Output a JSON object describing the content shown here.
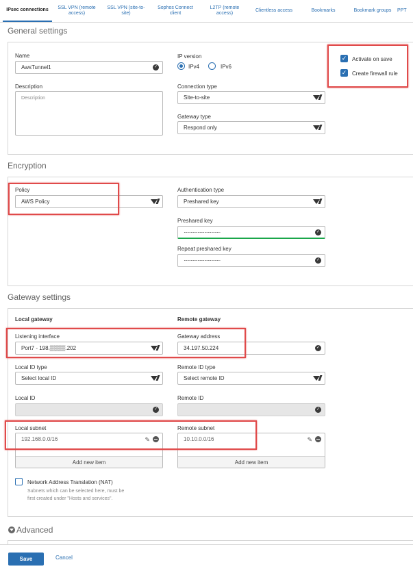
{
  "tabs": [
    {
      "label": "IPsec connections"
    },
    {
      "label": "SSL VPN (remote\naccess)"
    },
    {
      "label": "SSL VPN (site-to-\nsite)"
    },
    {
      "label": "Sophos Connect\nclient"
    },
    {
      "label": "L2TP (remote\naccess)"
    },
    {
      "label": "Clientless access"
    },
    {
      "label": "Bookmarks"
    },
    {
      "label": "Bookmark groups"
    },
    {
      "label": "PPT"
    }
  ],
  "general": {
    "title": "General settings",
    "name_label": "Name",
    "name_value": "AwsTunnel1",
    "description_label": "Description",
    "description_placeholder": "Description",
    "ip_version_label": "IP version",
    "ipv4": "IPv4",
    "ipv6": "IPv6",
    "connection_type_label": "Connection type",
    "connection_type_value": "Site-to-site",
    "gateway_type_label": "Gateway type",
    "gateway_type_value": "Respond only",
    "activate_on_save": "Activate on save",
    "create_firewall_rule": "Create firewall rule"
  },
  "encryption": {
    "title": "Encryption",
    "policy_label": "Policy",
    "policy_value": "AWS Policy",
    "auth_type_label": "Authentication type",
    "auth_type_value": "Preshared key",
    "psk_label": "Preshared key",
    "psk_value": "································",
    "repeat_psk_label": "Repeat preshared key",
    "repeat_psk_value": "································"
  },
  "gateway": {
    "title": "Gateway settings",
    "local_gateway": "Local gateway",
    "remote_gateway": "Remote gateway",
    "listening_interface_label": "Listening interface",
    "listening_interface_value": "Port7 - 198.▒▒▒▒.202",
    "gateway_address_label": "Gateway address",
    "gateway_address_value": "34.197.50.224",
    "local_id_type_label": "Local ID type",
    "local_id_type_value": "Select local ID",
    "remote_id_type_label": "Remote ID type",
    "remote_id_type_value": "Select remote ID",
    "local_id_label": "Local ID",
    "remote_id_label": "Remote ID",
    "local_subnet_label": "Local subnet",
    "local_subnet_value": "192.168.0.0/16",
    "remote_subnet_label": "Remote subnet",
    "remote_subnet_value": "10.10.0.0/16",
    "add_new_item": "Add new item",
    "nat_label": "Network Address Translation (NAT)",
    "nat_help": "Subnets which can be selected here, must be\nfirst created under \"Hosts and services\"."
  },
  "advanced": {
    "title": "Advanced"
  },
  "footer": {
    "save": "Save",
    "cancel": "Cancel"
  },
  "colors": {
    "accent": "#2a6fb2",
    "highlight": "#e04a4a"
  }
}
